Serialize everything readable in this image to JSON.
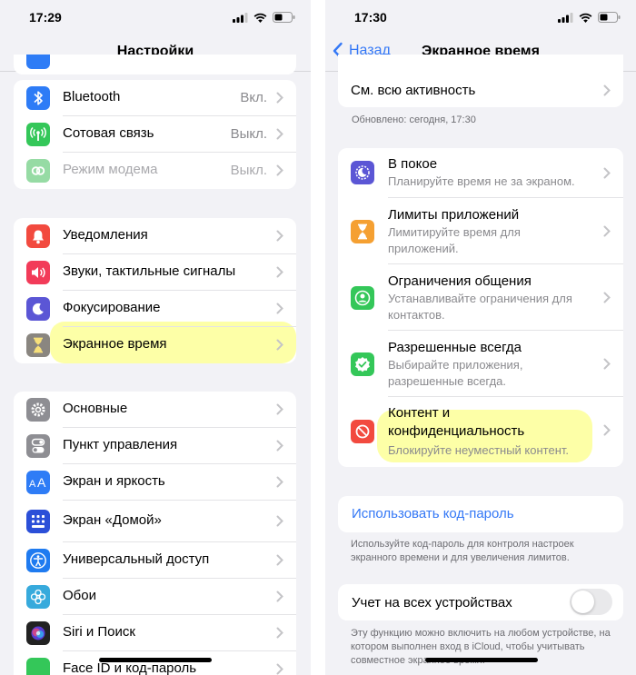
{
  "left": {
    "status_time": "17:29",
    "title": "Настройки",
    "group1": [
      {
        "label": "Bluetooth",
        "value": "Вкл.",
        "icon": "bluetooth-icon",
        "color": "#2e7cf6"
      },
      {
        "label": "Сотовая связь",
        "value": "Выкл.",
        "icon": "antenna-icon",
        "color": "#34c759"
      },
      {
        "label": "Режим модема",
        "value": "Выкл.",
        "icon": "chain-link-icon",
        "color": "#96dba4"
      }
    ],
    "group2": [
      {
        "label": "Уведомления",
        "icon": "bell-icon",
        "color": "#f24a3f"
      },
      {
        "label": "Звуки, тактильные сигналы",
        "icon": "speaker-icon",
        "color": "#f23b59"
      },
      {
        "label": "Фокусирование",
        "icon": "moon-icon",
        "color": "#5b56d5"
      },
      {
        "label": "Экранное время",
        "icon": "hourglass-icon",
        "color": "#8a8680"
      }
    ],
    "group3": [
      {
        "label": "Основные",
        "icon": "gear-icon",
        "color": "#8e8e93"
      },
      {
        "label": "Пункт управления",
        "icon": "toggles-icon",
        "color": "#8e8e93"
      },
      {
        "label": "Экран и яркость",
        "icon": "text-size-icon",
        "color": "#2e7cf6"
      },
      {
        "label": "Экран «Домой»",
        "icon": "home-grid-icon",
        "color": "#2b4fd8"
      },
      {
        "label": "Универсальный доступ",
        "icon": "accessibility-icon",
        "color": "#1f7bf0"
      },
      {
        "label": "Обои",
        "icon": "flower-icon",
        "color": "#37aadc"
      },
      {
        "label": "Siri и Поиск",
        "icon": "siri-icon",
        "color": "#222222"
      },
      {
        "label": "Face ID и код-пароль",
        "icon": "face-id-icon",
        "color": "#34c759"
      }
    ]
  },
  "right": {
    "status_time": "17:30",
    "back_label": "Назад",
    "title": "Экранное время",
    "activity_label": "См. всю активность",
    "updated": "Обновлено: сегодня, 17:30",
    "items": [
      {
        "title": "В покое",
        "subtitle": "Планируйте время не за экраном.",
        "icon": "downtime-icon",
        "color": "#5b56d5"
      },
      {
        "title": "Лимиты приложений",
        "subtitle": "Лимитируйте время для приложений.",
        "icon": "hourglass-icon",
        "color": "#f5a032"
      },
      {
        "title": "Ограничения общения",
        "subtitle": "Устанавливайте ограничения для контактов.",
        "icon": "person-circle-icon",
        "color": "#34c759"
      },
      {
        "title": "Разрешенные всегда",
        "subtitle": "Выбирайте приложения, разрешенные всегда.",
        "icon": "checkmark-badge-icon",
        "color": "#34c759"
      },
      {
        "title": "Контент и конфиденциальность",
        "subtitle": "Блокируйте неуместный контент.",
        "icon": "no-entry-icon",
        "color": "#f24a3f"
      }
    ],
    "passcode_label": "Использовать код-пароль",
    "passcode_note": "Используйте код-пароль для контроля настроек экранного времени и для увеличения лимитов.",
    "share_label": "Учет на всех устройствах",
    "share_note": "Эту функцию можно включить на любом устройстве, на котором выполнен вход в iCloud, чтобы учитывать совместное экранное время.",
    "share_toggle_on": false
  }
}
